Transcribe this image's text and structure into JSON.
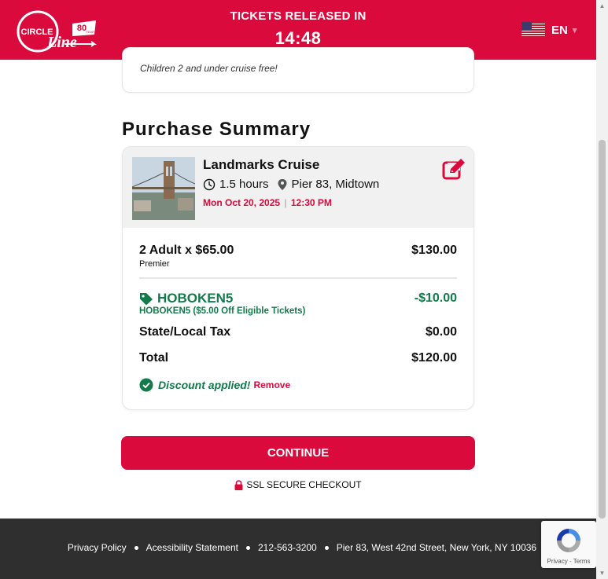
{
  "header": {
    "logo_circle_text": "CIRCLE",
    "logo_line_text": "Line",
    "logo_badge_text": "80",
    "logo_badge_sub": "YEARS",
    "timer_label": "TICKETS RELEASED IN",
    "timer_value": "14:48",
    "language": "EN",
    "flag_icon": "us-flag-icon",
    "brand_color": "#da0a3c"
  },
  "previous_section": {
    "note": "Children 2 and under cruise free!"
  },
  "summary": {
    "title": "Purchase Summary",
    "tour": {
      "name": "Landmarks Cruise",
      "duration": "1.5 hours",
      "location": "Pier 83, Midtown",
      "date": "Mon Oct 20, 2025",
      "date_separator": "|",
      "time": "12:30 PM"
    },
    "line_item": {
      "label": "2 Adult x $65.00",
      "sublabel": "Premier",
      "value": "$130.00"
    },
    "promo": {
      "code": "HOBOKEN5",
      "description": "HOBOKEN5 ($5.00 Off Eligible Tickets)",
      "value": "-$10.00",
      "color": "#137a4b"
    },
    "tax": {
      "label": "State/Local Tax",
      "value": "$0.00"
    },
    "total": {
      "label": "Total",
      "value": "$120.00"
    },
    "discount_message": "Discount applied!",
    "remove_label": "Remove"
  },
  "actions": {
    "continue_label": "CONTINUE",
    "ssl_label": "SSL SECURE CHECKOUT"
  },
  "footer": {
    "links": [
      "Privacy Policy",
      "Acessibility Statement",
      "212-563-3200",
      "Pier 83, West 42nd Street, New York, NY 10036"
    ],
    "background": "#2f2f2f"
  },
  "recaptcha": {
    "terms": "Privacy - Terms"
  }
}
